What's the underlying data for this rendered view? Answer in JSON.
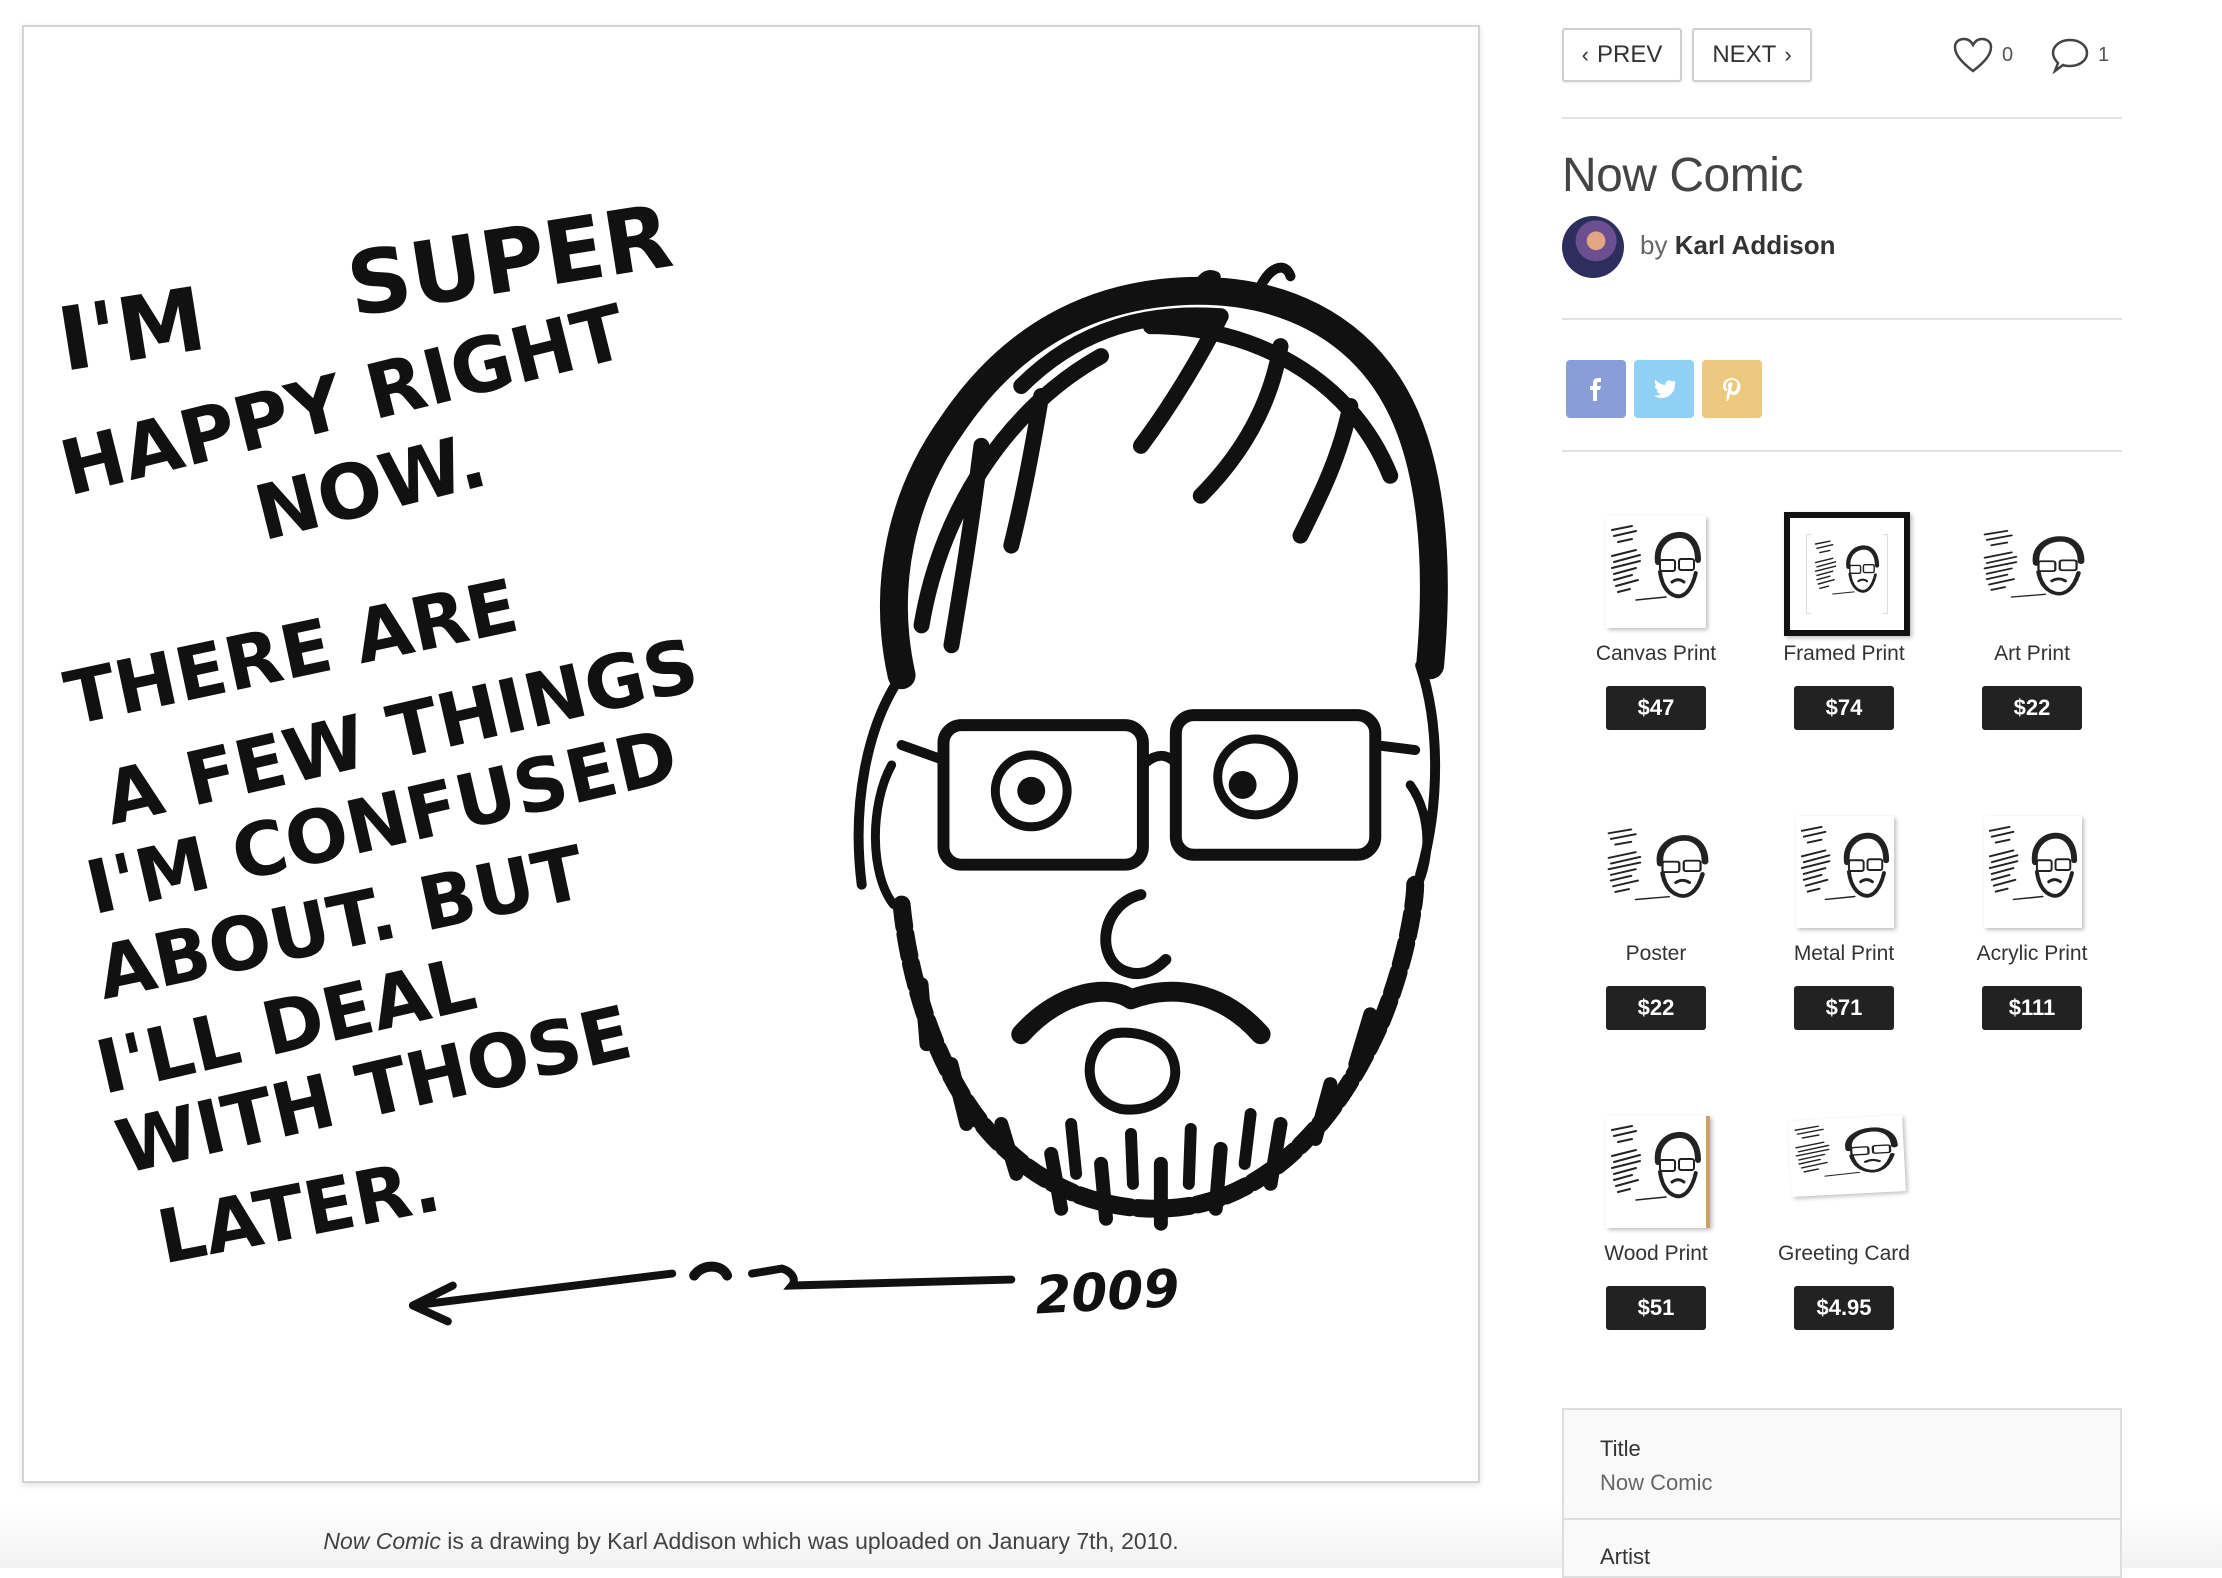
{
  "artwork": {
    "text_lines": [
      "I'M",
      "SUPER",
      "HAPPY RIGHT",
      "NOW.",
      "THERE ARE",
      "A FEW THINGS",
      "I'M CONFUSED",
      "ABOUT. BUT",
      "I'LL DEAL",
      "WITH THOSE",
      "LATER."
    ],
    "signature_year": "2009"
  },
  "caption": {
    "title": "Now Comic",
    "rest": " is a drawing by Karl Addison which was uploaded on January 7th, 2010."
  },
  "nav": {
    "prev_label": "PREV",
    "next_label": "NEXT"
  },
  "counters": {
    "likes": "0",
    "comments": "1",
    "like_icon": "heart-icon",
    "comment_icon": "speech-bubble-icon"
  },
  "title": "Now Comic",
  "byline": {
    "prefix": "by",
    "artist": "Karl Addison"
  },
  "share": [
    {
      "network": "facebook",
      "icon": "facebook-icon",
      "color": "#8b9dd6"
    },
    {
      "network": "twitter",
      "icon": "twitter-icon",
      "color": "#8fd0f4"
    },
    {
      "network": "pinterest",
      "icon": "pinterest-icon",
      "color": "#ecc97e"
    }
  ],
  "products": [
    {
      "name": "Canvas Print",
      "price": "$47"
    },
    {
      "name": "Framed Print",
      "price": "$74"
    },
    {
      "name": "Art Print",
      "price": "$22"
    },
    {
      "name": "Poster",
      "price": "$22"
    },
    {
      "name": "Metal Print",
      "price": "$71"
    },
    {
      "name": "Acrylic Print",
      "price": "$111"
    },
    {
      "name": "Wood Print",
      "price": "$51"
    },
    {
      "name": "Greeting Card",
      "price": "$4.95"
    }
  ],
  "details": {
    "title_label": "Title",
    "title_value": "Now Comic",
    "artist_label": "Artist"
  }
}
